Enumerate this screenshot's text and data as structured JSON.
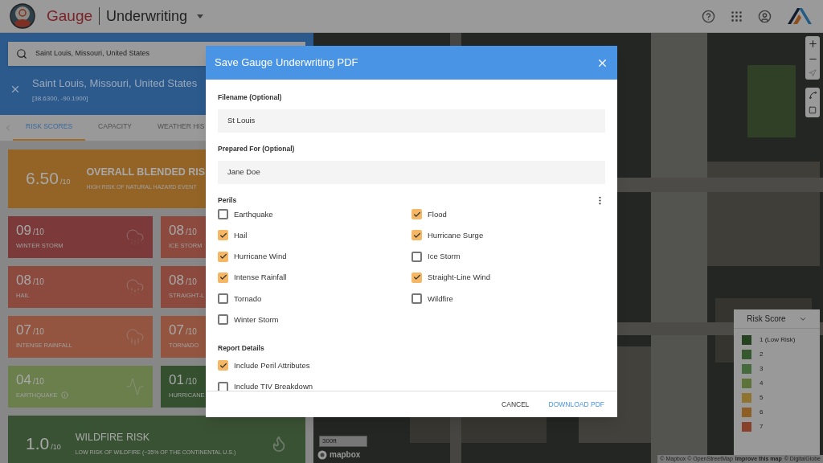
{
  "header": {
    "brand": "Gauge",
    "product": "Underwriting"
  },
  "sidebar": {
    "search": {
      "value": "Saint Louis, Missouri, United States"
    },
    "location": {
      "title": "Saint Louis, Missouri, United States",
      "coords": "[38.6300, -90.1900]"
    },
    "tabs": [
      {
        "label": "RISK SCORES",
        "selected": true
      },
      {
        "label": "CAPACITY",
        "selected": false
      },
      {
        "label": "WEATHER HIS",
        "selected": false
      }
    ],
    "overall": {
      "score": "6.50",
      "out_of": "/10",
      "title": "OVERALL BLENDED RIS",
      "subtitle": "HIGH RISK OF NATURAL HAZARD EVENT",
      "color": "#946427"
    },
    "cards": [
      {
        "score": "09",
        "out_of": "/10",
        "label": "WINTER STORM",
        "color": "#7b3a39",
        "info": false
      },
      {
        "score": "08",
        "out_of": "/10",
        "label": "ICE STORM",
        "color": "#8c4a3e",
        "info": false
      },
      {
        "score": "08",
        "out_of": "/10",
        "label": "HAIL",
        "color": "#8c4a3e",
        "info": false
      },
      {
        "score": "08",
        "out_of": "/10",
        "label": "STRAIGHT-L",
        "color": "#8c4a3e",
        "info": false
      },
      {
        "score": "07",
        "out_of": "/10",
        "label": "INTENSE RAINFALL",
        "color": "#93553f",
        "info": false
      },
      {
        "score": "07",
        "out_of": "/10",
        "label": "TORNADO",
        "color": "#93553f",
        "info": false
      },
      {
        "score": "04",
        "out_of": "/10",
        "label": "EARTHQUAKE",
        "color": "#6b7f4c",
        "info": true
      },
      {
        "score": "01",
        "out_of": "/10",
        "label": "HURRICANE",
        "color": "#34502f",
        "info": false
      }
    ],
    "wildfire": {
      "score": "1.0",
      "out_of": "/10",
      "title": "WILDFIRE RISK",
      "subtitle": "LOW RISK OF WILDFIRE (~35% OF THE CONTINENTAL U.S.)",
      "color": "#3a5234"
    }
  },
  "map": {
    "scale": "300ft",
    "logo": "mapbox",
    "attribution": "© Mapbox © OpenStreetMap",
    "improve": "Improve this map",
    "attribution_end": "© DigitalGlobe",
    "legend": {
      "title": "Risk Score",
      "items": [
        {
          "label": "1 (Low Risk)",
          "color": "#24421f"
        },
        {
          "label": "2",
          "color": "#35582f"
        },
        {
          "label": "3",
          "color": "#456b3c"
        },
        {
          "label": "4",
          "color": "#5c7439"
        },
        {
          "label": "5",
          "color": "#8f7430"
        },
        {
          "label": "6",
          "color": "#8d5f25"
        },
        {
          "label": "7",
          "color": "#88402a"
        }
      ]
    }
  },
  "dialog": {
    "title": "Save Gauge Underwriting PDF",
    "fields": [
      {
        "label": "Filename (Optional)",
        "value": "St Louis"
      },
      {
        "label": "Prepared For (Optional)",
        "value": "Jane Doe"
      }
    ],
    "perils": {
      "title": "Perils",
      "items": [
        {
          "label": "Earthquake",
          "checked": false
        },
        {
          "label": "Hail",
          "checked": true
        },
        {
          "label": "Hurricane Wind",
          "checked": true
        },
        {
          "label": "Intense Rainfall",
          "checked": true
        },
        {
          "label": "Tornado",
          "checked": false
        },
        {
          "label": "Winter Storm",
          "checked": false
        },
        {
          "label": "Flood",
          "checked": true
        },
        {
          "label": "Hurricane Surge",
          "checked": true
        },
        {
          "label": "Ice Storm",
          "checked": false
        },
        {
          "label": "Straight-Line Wind",
          "checked": true
        },
        {
          "label": "Wildfire",
          "checked": false
        }
      ]
    },
    "report": {
      "title": "Report Details",
      "items": [
        {
          "label": "Include Peril Attributes",
          "checked": true
        },
        {
          "label": "Include TIV Breakdown",
          "checked": false
        }
      ]
    },
    "buttons": [
      {
        "label": "CANCEL",
        "kind": "plain"
      },
      {
        "label": "DOWNLOAD PDF",
        "kind": "primary"
      }
    ]
  }
}
